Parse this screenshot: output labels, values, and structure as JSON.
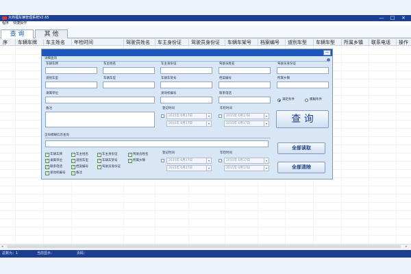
{
  "window": {
    "title": "大商福车辆管理系统V2.65",
    "min": "—",
    "max": "□",
    "close": "×"
  },
  "menu": [
    "程序",
    "快捷操作"
  ],
  "tabs": [
    {
      "label": "查 询",
      "active": true
    },
    {
      "label": "其 他",
      "active": false
    }
  ],
  "grid": {
    "columns": [
      "序",
      "车辆车牌",
      "车主姓名",
      "年检时间",
      "驾驶员姓名",
      "车主身份证",
      "驾驶员身份证",
      "车辆车架号",
      "档案编号",
      "道别车型",
      "车辆车型",
      "所属乡镇",
      "联系电话",
      "操作"
    ]
  },
  "scroll": {
    "left": "◂",
    "right": "▸"
  },
  "status": [
    "总数为：1",
    "当前显示：",
    "页码："
  ],
  "dialog": {
    "close_label": "—",
    "detail_section": "详细查询",
    "fields": {
      "plate": "车辆车牌",
      "owner_name": "车主姓名",
      "owner_id": "车主身份证",
      "driver_name": "驾驶员姓名",
      "driver_id": "驾驶员身份证",
      "road_type": "道别车型",
      "vehicle_type": "车辆车型",
      "frame_no": "车辆车架号",
      "archive_no": "档案编号",
      "township": "所属乡镇",
      "unit": "隶属单位",
      "engine_no": "发动机编号",
      "phone": "联系电话",
      "remark": "备注"
    },
    "time_labels": {
      "register": "登记时间",
      "inspect": "年检时间"
    },
    "date_value": "2015年 6月17日",
    "radios": [
      {
        "label": "满足条件",
        "selected": true
      },
      {
        "label": "模糊条件",
        "selected": false
      }
    ],
    "query_button": "查 询",
    "fuzzy_section": "全局模糊信息查询",
    "checks": [
      "车辆车牌",
      "车主姓名",
      "车主身份证",
      "驾驶员姓名",
      "隶属单位",
      "道别车型",
      "车辆车架号",
      "所属乡镇",
      "联系电话",
      "档案编号",
      "驾驶员身份证",
      "发动机编号",
      "备注"
    ],
    "read_all_button": "全部读取",
    "clear_all_button": "全部清除"
  }
}
